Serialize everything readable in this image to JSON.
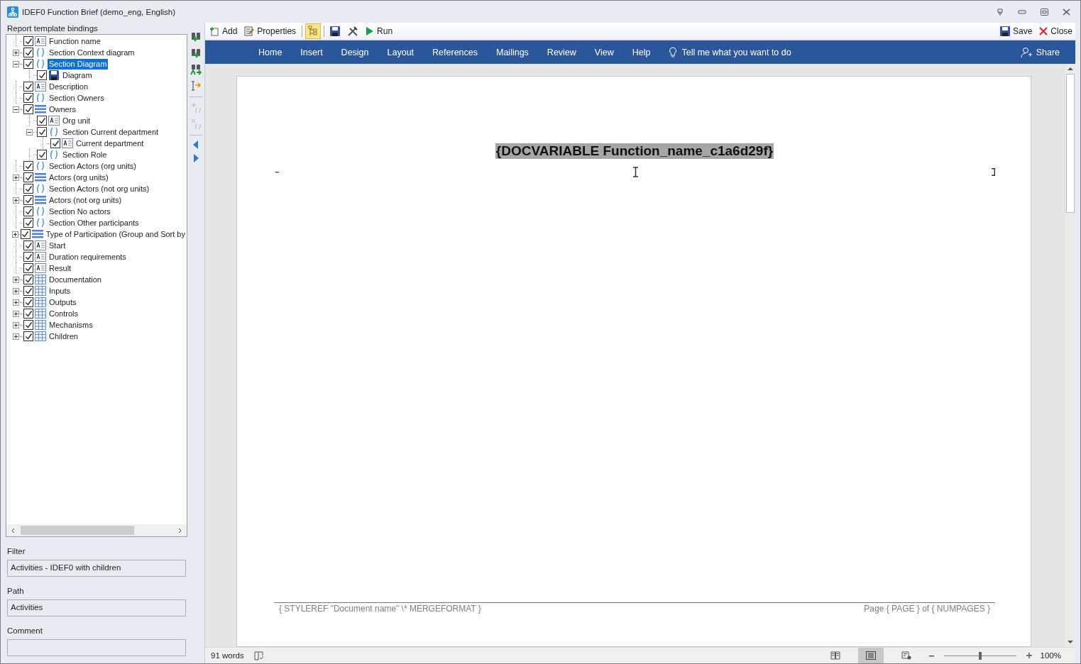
{
  "window": {
    "title": "IDEF0 Function Brief (demo_eng, English)"
  },
  "left_panel": {
    "title": "Report template bindings",
    "tree": [
      {
        "label": "Function name",
        "kind": "text",
        "checked": true,
        "selected": false
      },
      {
        "label": "Section Context diagram",
        "kind": "section",
        "checked": true,
        "selected": false,
        "expanded": false
      },
      {
        "label": "Section Diagram",
        "kind": "section",
        "checked": true,
        "selected": true,
        "expanded": true,
        "children": [
          {
            "label": "Diagram",
            "kind": "image",
            "checked": true,
            "selected": false
          }
        ]
      },
      {
        "label": "Description",
        "kind": "text",
        "checked": true,
        "selected": false
      },
      {
        "label": "Section Owners",
        "kind": "section",
        "checked": true,
        "selected": false
      },
      {
        "label": "Owners",
        "kind": "list",
        "checked": true,
        "selected": false,
        "expanded": true,
        "children": [
          {
            "label": "Org unit",
            "kind": "text",
            "checked": true,
            "selected": false
          },
          {
            "label": "Section Current department",
            "kind": "section",
            "checked": true,
            "selected": false,
            "expanded": true,
            "children": [
              {
                "label": "Current department",
                "kind": "text",
                "checked": true,
                "selected": false
              }
            ]
          },
          {
            "label": "Section Role",
            "kind": "section",
            "checked": true,
            "selected": false
          }
        ]
      },
      {
        "label": "Section Actors (org units)",
        "kind": "section",
        "checked": true,
        "selected": false
      },
      {
        "label": "Actors (org units)",
        "kind": "list",
        "checked": true,
        "selected": false,
        "expanded": false
      },
      {
        "label": "Section Actors (not org units)",
        "kind": "section",
        "checked": true,
        "selected": false
      },
      {
        "label": "Actors (not org units)",
        "kind": "list",
        "checked": true,
        "selected": false,
        "expanded": false
      },
      {
        "label": "Section No actors",
        "kind": "section",
        "checked": true,
        "selected": false
      },
      {
        "label": "Section Other participants",
        "kind": "section",
        "checked": true,
        "selected": false
      },
      {
        "label": "Type of Participation (Group and Sort by",
        "kind": "list",
        "checked": true,
        "selected": false,
        "expanded": false
      },
      {
        "label": "Start",
        "kind": "text",
        "checked": true,
        "selected": false
      },
      {
        "label": "Duration requirements",
        "kind": "text",
        "checked": true,
        "selected": false
      },
      {
        "label": "Result",
        "kind": "text",
        "checked": true,
        "selected": false
      },
      {
        "label": "Documentation",
        "kind": "table",
        "checked": true,
        "selected": false,
        "expanded": false
      },
      {
        "label": "Inputs",
        "kind": "table",
        "checked": true,
        "selected": false,
        "expanded": false
      },
      {
        "label": "Outputs",
        "kind": "table",
        "checked": true,
        "selected": false,
        "expanded": false
      },
      {
        "label": "Controls",
        "kind": "table",
        "checked": true,
        "selected": false,
        "expanded": false
      },
      {
        "label": "Mechanisms",
        "kind": "table",
        "checked": true,
        "selected": false,
        "expanded": false
      },
      {
        "label": "Children",
        "kind": "table",
        "checked": true,
        "selected": false,
        "expanded": false
      }
    ],
    "fields": [
      {
        "label": "Filter",
        "value": "Activities - IDEF0 with children"
      },
      {
        "label": "Path",
        "value": "Activities"
      },
      {
        "label": "Comment"
      }
    ]
  },
  "toolbar": {
    "left": [
      {
        "label": "Add",
        "kind": "add"
      },
      {
        "label": "Properties",
        "kind": "properties"
      },
      {
        "kind": "tree",
        "selected": true
      },
      {
        "kind": "save",
        "selected": false
      },
      {
        "kind": "tools",
        "selected": false
      },
      {
        "label": "Run",
        "kind": "run"
      }
    ],
    "right": [
      {
        "label": "Save",
        "kind": "save"
      },
      {
        "label": "Close",
        "kind": "close"
      }
    ]
  },
  "ribbon": {
    "tabs": [
      "Home",
      "Insert",
      "Design",
      "Layout",
      "References",
      "Mailings",
      "Review",
      "View",
      "Help"
    ],
    "tell_me": "Tell me what you want to do",
    "share": "Share"
  },
  "document": {
    "field": "{DOCVARIABLE Function_name_c1a6d29f}",
    "footer_left": "{ STYLEREF  \"Document name\"  \\* MERGEFORMAT }",
    "footer_right": "Page { PAGE } of { NUMPAGES }"
  },
  "status_bar": {
    "words": "91 words",
    "views": [
      {
        "kind": "read",
        "selected": false
      },
      {
        "kind": "print",
        "selected": true
      },
      {
        "kind": "web",
        "selected": false
      }
    ],
    "zoom": {
      "level": 0.5,
      "reading": "100%"
    }
  }
}
